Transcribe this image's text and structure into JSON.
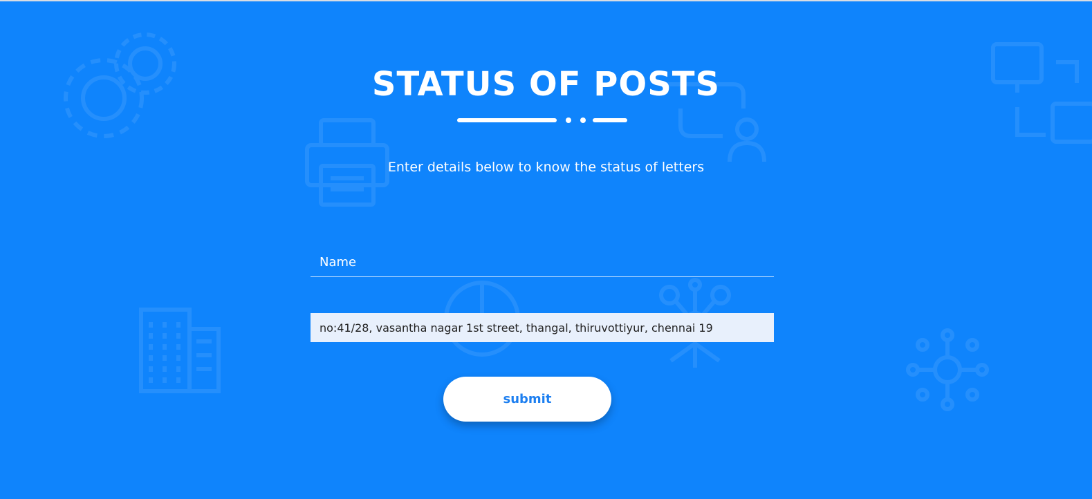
{
  "page": {
    "title": "STATUS OF POSTS",
    "subtitle": "Enter details below to know the status of letters",
    "background_color": "#0f84fc"
  },
  "form": {
    "name_placeholder": "Name",
    "name_value": "",
    "address_value": "no:41/28, vasantha nagar 1st street, thangal, thiruvottiyur, chennai 19",
    "submit_label": "submit"
  },
  "background_icons": [
    "gears-icon",
    "printer-icon",
    "user-flow-icon",
    "monitor-network-icon",
    "building-icon",
    "pie-chart-icon",
    "search-network-icon",
    "dollar-network-icon"
  ]
}
